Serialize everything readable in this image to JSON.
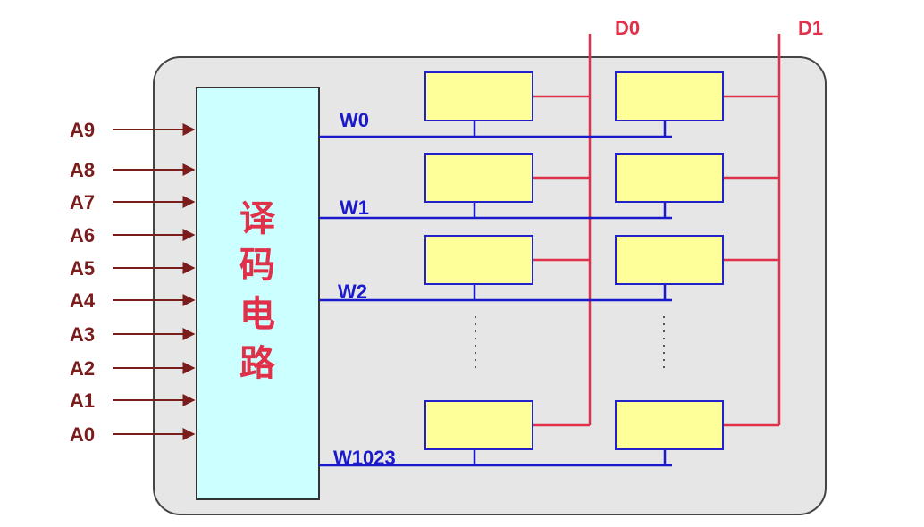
{
  "address_lines": [
    "A9",
    "A8",
    "A7",
    "A6",
    "A5",
    "A4",
    "A3",
    "A2",
    "A1",
    "A0"
  ],
  "decoder": {
    "chars": [
      "译",
      "码",
      "电",
      "路"
    ],
    "fill": "#ccffff"
  },
  "word_lines": [
    "W0",
    "W1",
    "W2",
    "W1023"
  ],
  "data_lines": [
    "D0",
    "D1"
  ],
  "colors": {
    "address": "#7a1c1c",
    "word": "#1a1acc",
    "data": "#e0304a",
    "cell_fill": "#ffff99",
    "cell_border": "#2222cc",
    "panel_fill": "#e6e6e6",
    "panel_border": "#444444"
  }
}
